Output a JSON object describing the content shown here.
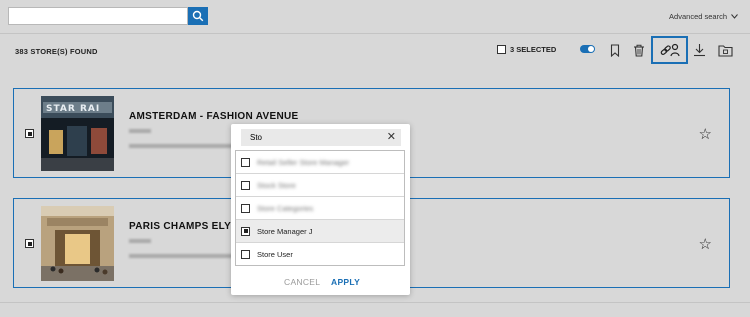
{
  "topbar": {
    "search_placeholder": "",
    "search_icon": "search-icon",
    "advanced_search_label": "Advanced search",
    "advanced_icon": "chevron-down-icon"
  },
  "results": {
    "count_label": "383 STORE(S) FOUND",
    "selected_label": "3 SELECTED"
  },
  "toolbar": {
    "icons": [
      "toggle-icon",
      "bookmark-icon",
      "trash-icon",
      "link-user-icon",
      "download-icon",
      "folder-icon"
    ],
    "accent": "#1a6fb5"
  },
  "stores": [
    {
      "name": "AMSTERDAM - FASHION AVENUE",
      "checked": true,
      "starred": false
    },
    {
      "name": "PARIS CHAMPS ELYSEE",
      "checked": true,
      "starred": false
    }
  ],
  "modal": {
    "search_value": "Sto",
    "options": [
      {
        "label": "Retail Seller Store Manager",
        "checked": false,
        "blurred": true
      },
      {
        "label": "Stock Store",
        "checked": false,
        "blurred": true
      },
      {
        "label": "Store Categories",
        "checked": false,
        "blurred": true
      },
      {
        "label": "Store Manager J",
        "checked": true,
        "blurred": false
      },
      {
        "label": "Store User",
        "checked": false,
        "blurred": false
      }
    ],
    "cancel_label": "CANCEL",
    "apply_label": "APPLY"
  }
}
